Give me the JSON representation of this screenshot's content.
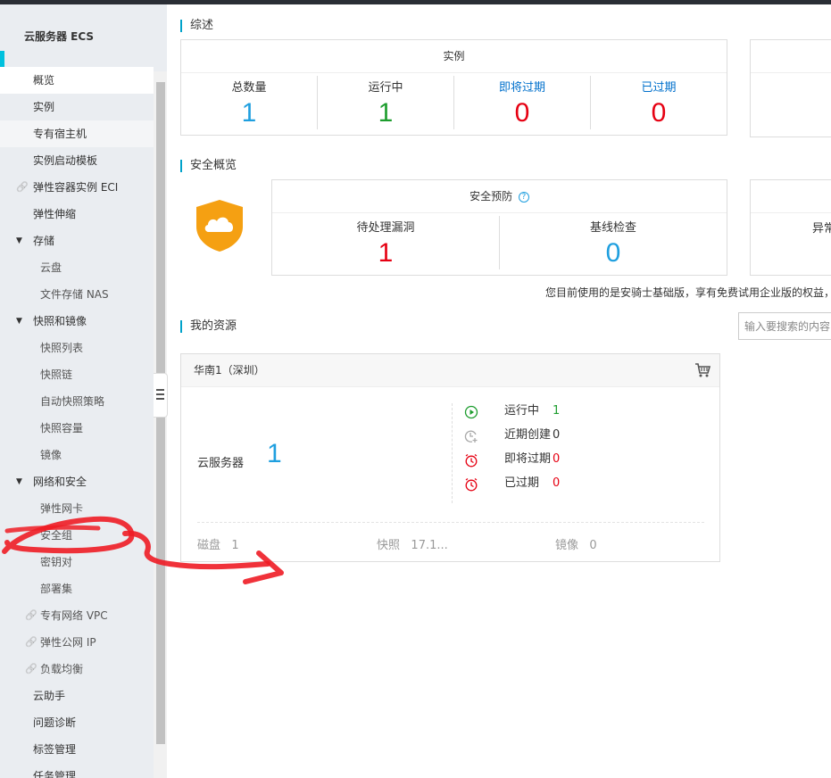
{
  "sidebar": {
    "title": "云服务器 ECS",
    "items": [
      {
        "label": "概览",
        "kind": "top",
        "state": "active"
      },
      {
        "label": "实例",
        "kind": "top"
      },
      {
        "label": "专有宿主机",
        "kind": "top",
        "state": "hover"
      },
      {
        "label": "实例启动模板",
        "kind": "top"
      },
      {
        "label": "弹性容器实例 ECI",
        "kind": "top",
        "link": true
      },
      {
        "label": "弹性伸缩",
        "kind": "top"
      },
      {
        "label": "存储",
        "kind": "group"
      },
      {
        "label": "云盘",
        "kind": "sub"
      },
      {
        "label": "文件存储 NAS",
        "kind": "sub"
      },
      {
        "label": "快照和镜像",
        "kind": "group"
      },
      {
        "label": "快照列表",
        "kind": "sub"
      },
      {
        "label": "快照链",
        "kind": "sub"
      },
      {
        "label": "自动快照策略",
        "kind": "sub"
      },
      {
        "label": "快照容量",
        "kind": "sub"
      },
      {
        "label": "镜像",
        "kind": "sub"
      },
      {
        "label": "网络和安全",
        "kind": "group"
      },
      {
        "label": "弹性网卡",
        "kind": "sub"
      },
      {
        "label": "安全组",
        "kind": "sub"
      },
      {
        "label": "密钥对",
        "kind": "sub"
      },
      {
        "label": "部署集",
        "kind": "sub"
      },
      {
        "label": "专有网络 VPC",
        "kind": "sub",
        "link": true
      },
      {
        "label": "弹性公网 IP",
        "kind": "sub",
        "link": true
      },
      {
        "label": "负载均衡",
        "kind": "sub",
        "link": true
      },
      {
        "label": "云助手",
        "kind": "top"
      },
      {
        "label": "问题诊断",
        "kind": "top"
      },
      {
        "label": "标签管理",
        "kind": "top"
      },
      {
        "label": "任务管理",
        "kind": "top"
      }
    ]
  },
  "overview": {
    "title": "综述",
    "instances_card": {
      "header": "实例",
      "stats": [
        {
          "label": "总数量",
          "value": "1",
          "color": "#1f9fdf"
        },
        {
          "label": "运行中",
          "value": "1",
          "color": "#1d9d2e"
        },
        {
          "label": "即将过期",
          "value": "0",
          "color": "#e60012"
        },
        {
          "label": "已过期",
          "value": "0",
          "color": "#e60012"
        }
      ]
    }
  },
  "security": {
    "title": "安全概览",
    "card": {
      "header": "安全预防",
      "stats": [
        {
          "label": "待处理漏洞",
          "value": "1"
        },
        {
          "label": "基线检查",
          "value": "0"
        }
      ]
    },
    "partial_card_label": "异常",
    "note": "您目前使用的是安骑士基础版，享有免费试用企业版的权益，"
  },
  "resources": {
    "title": "我的资源",
    "search_placeholder": "输入要搜索的内容",
    "region": "华南1（深圳）",
    "ecs_label": "云服务器",
    "ecs_count": "1",
    "statuses": [
      {
        "label": "运行中",
        "value": "1",
        "icon": "play-icon",
        "color": "#1d9d2e"
      },
      {
        "label": "近期创建",
        "value": "0",
        "icon": "clock-plus-icon",
        "color": "#999999"
      },
      {
        "label": "即将过期",
        "value": "0",
        "icon": "alarm-icon",
        "color": "#e60012"
      },
      {
        "label": "已过期",
        "value": "0",
        "icon": "alarm-icon",
        "color": "#e60012"
      }
    ],
    "footer": [
      {
        "label": "磁盘",
        "value": "1"
      },
      {
        "label": "快照",
        "value": "17.1..."
      },
      {
        "label": "镜像",
        "value": "0"
      }
    ]
  }
}
